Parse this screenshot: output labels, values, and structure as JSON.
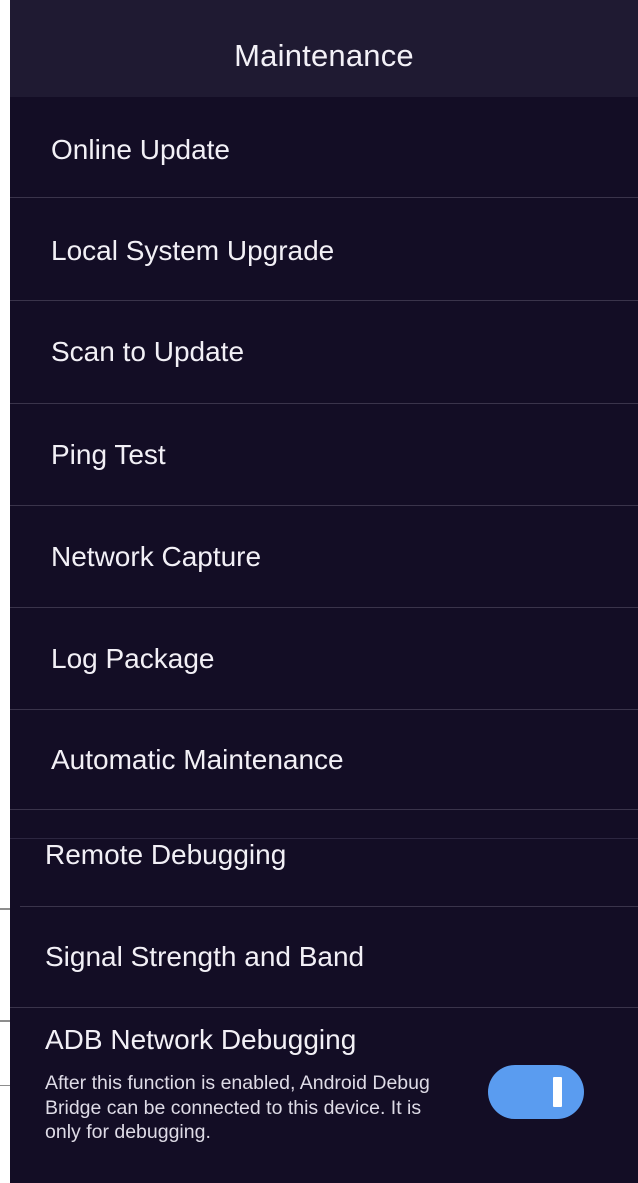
{
  "header": {
    "title": "Maintenance"
  },
  "menu": {
    "items": [
      {
        "id": "online-update",
        "label": "Online Update"
      },
      {
        "id": "local-system-upgrade",
        "label": "Local System Upgrade"
      },
      {
        "id": "scan-to-update",
        "label": "Scan to Update"
      },
      {
        "id": "ping-test",
        "label": "Ping Test"
      },
      {
        "id": "network-capture",
        "label": "Network Capture"
      },
      {
        "id": "log-package",
        "label": "Log Package"
      },
      {
        "id": "automatic-maintenance",
        "label": "Automatic Maintenance"
      },
      {
        "id": "remote-debugging",
        "label": "Remote Debugging"
      },
      {
        "id": "signal-strength-and-band",
        "label": "Signal Strength and Band"
      }
    ]
  },
  "adb": {
    "title": "ADB Network Debugging",
    "description": "After this function is enabled, Android Debug Bridge can be connected to this device. It is only for debugging.",
    "enabled": true
  },
  "colors": {
    "background": "#130d25",
    "header": "#1f1a32",
    "divider": "#3a344b",
    "toggle_on": "#5a9cf0",
    "text": "#f2f0f6"
  }
}
